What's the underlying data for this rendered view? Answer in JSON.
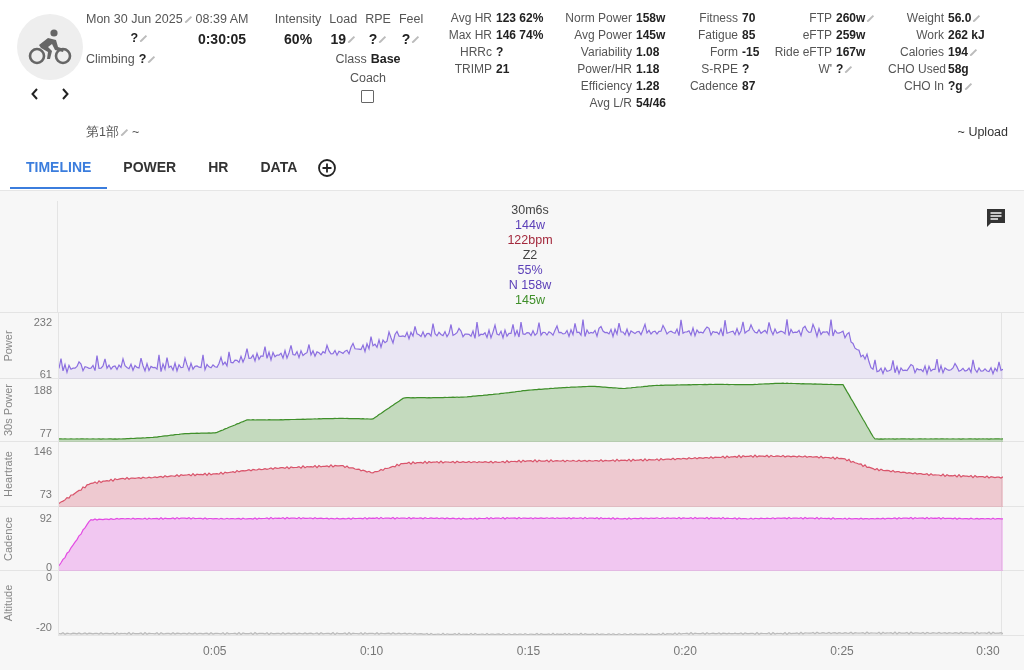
{
  "activity": {
    "date": "Mon 30 Jun 2025",
    "date_value": "?",
    "time": "08:39 AM",
    "duration": "0:30:05",
    "climbing_label": "Climbing",
    "climbing_value": "?"
  },
  "top_metrics": [
    {
      "label": "Intensity",
      "value": "60%",
      "editable": false
    },
    {
      "label": "Load",
      "value": "19",
      "editable": true
    },
    {
      "label": "RPE",
      "value": "?",
      "editable": true
    },
    {
      "label": "Feel",
      "value": "?",
      "editable": true
    }
  ],
  "class": {
    "label": "Class",
    "value": "Base"
  },
  "coach": {
    "label": "Coach",
    "checked": false
  },
  "stat_columns": [
    [
      {
        "label": "Avg HR",
        "value": "123 62%",
        "editable": false
      },
      {
        "label": "Max HR",
        "value": "146 74%",
        "editable": false
      },
      {
        "label": "HRRc",
        "value": "?",
        "editable": false
      },
      {
        "label": "TRIMP",
        "value": "21",
        "editable": false
      }
    ],
    [
      {
        "label": "Norm Power",
        "value": "158w",
        "editable": false
      },
      {
        "label": "Avg Power",
        "value": "145w",
        "editable": false
      },
      {
        "label": "Variability",
        "value": "1.08",
        "editable": false
      },
      {
        "label": "Power/HR",
        "value": "1.18",
        "editable": false
      },
      {
        "label": "Efficiency",
        "value": "1.28",
        "editable": false
      },
      {
        "label": "Avg L/R",
        "value": "54/46",
        "editable": false
      }
    ],
    [
      {
        "label": "Fitness",
        "value": "70",
        "editable": false
      },
      {
        "label": "Fatigue",
        "value": "85",
        "editable": false
      },
      {
        "label": "Form",
        "value": "-15",
        "editable": false
      },
      {
        "label": "S-RPE",
        "value": "?",
        "editable": false
      },
      {
        "label": "Cadence",
        "value": "87",
        "editable": false
      }
    ],
    [
      {
        "label": "FTP",
        "value": "260w",
        "editable": true
      },
      {
        "label": "eFTP",
        "value": "259w",
        "editable": false
      },
      {
        "label": "Ride eFTP",
        "value": "167w",
        "editable": false
      },
      {
        "label": "W'",
        "value": "?",
        "editable": true
      }
    ],
    [
      {
        "label": "Weight",
        "value": "56.0",
        "editable": true
      },
      {
        "label": "Work",
        "value": "262 kJ",
        "editable": false
      },
      {
        "label": "Calories",
        "value": "194",
        "editable": true
      },
      {
        "label": "CHO Used",
        "value": "58g",
        "editable": false
      },
      {
        "label": "CHO In",
        "value": "?g",
        "editable": true
      }
    ]
  ],
  "activity_name": {
    "value": "第1部",
    "suffix": "~"
  },
  "upload": "~ Upload",
  "tabs": [
    {
      "label": "TIMELINE",
      "selected": true
    },
    {
      "label": "POWER",
      "selected": false
    },
    {
      "label": "HR",
      "selected": false
    },
    {
      "label": "DATA",
      "selected": false
    }
  ],
  "summary": [
    {
      "text": "30m6s",
      "color": "#444444"
    },
    {
      "text": "144w",
      "color": "#5b3fb8"
    },
    {
      "text": "122bpm",
      "color": "#a3283c"
    },
    {
      "text": "Z2",
      "color": "#444444"
    },
    {
      "text": "55%",
      "color": "#5b3fb8"
    },
    {
      "text": "N 158w",
      "color": "#5b3fb8"
    },
    {
      "text": "145w",
      "color": "#3f8f2a"
    }
  ],
  "panels": [
    {
      "label": "Power",
      "ticks": [
        "232",
        "61"
      ]
    },
    {
      "label": "30s Power",
      "ticks": [
        "188",
        "77"
      ]
    },
    {
      "label": "Heartrate",
      "ticks": [
        "146",
        "73"
      ]
    },
    {
      "label": "Cadence",
      "ticks": [
        "92",
        "0"
      ]
    },
    {
      "label": "Altitude",
      "ticks": [
        "0",
        "-20"
      ]
    }
  ],
  "x_axis": {
    "ticks": [
      "0:05",
      "0:10",
      "0:15",
      "0:20",
      "0:25",
      "0:30"
    ]
  }
}
